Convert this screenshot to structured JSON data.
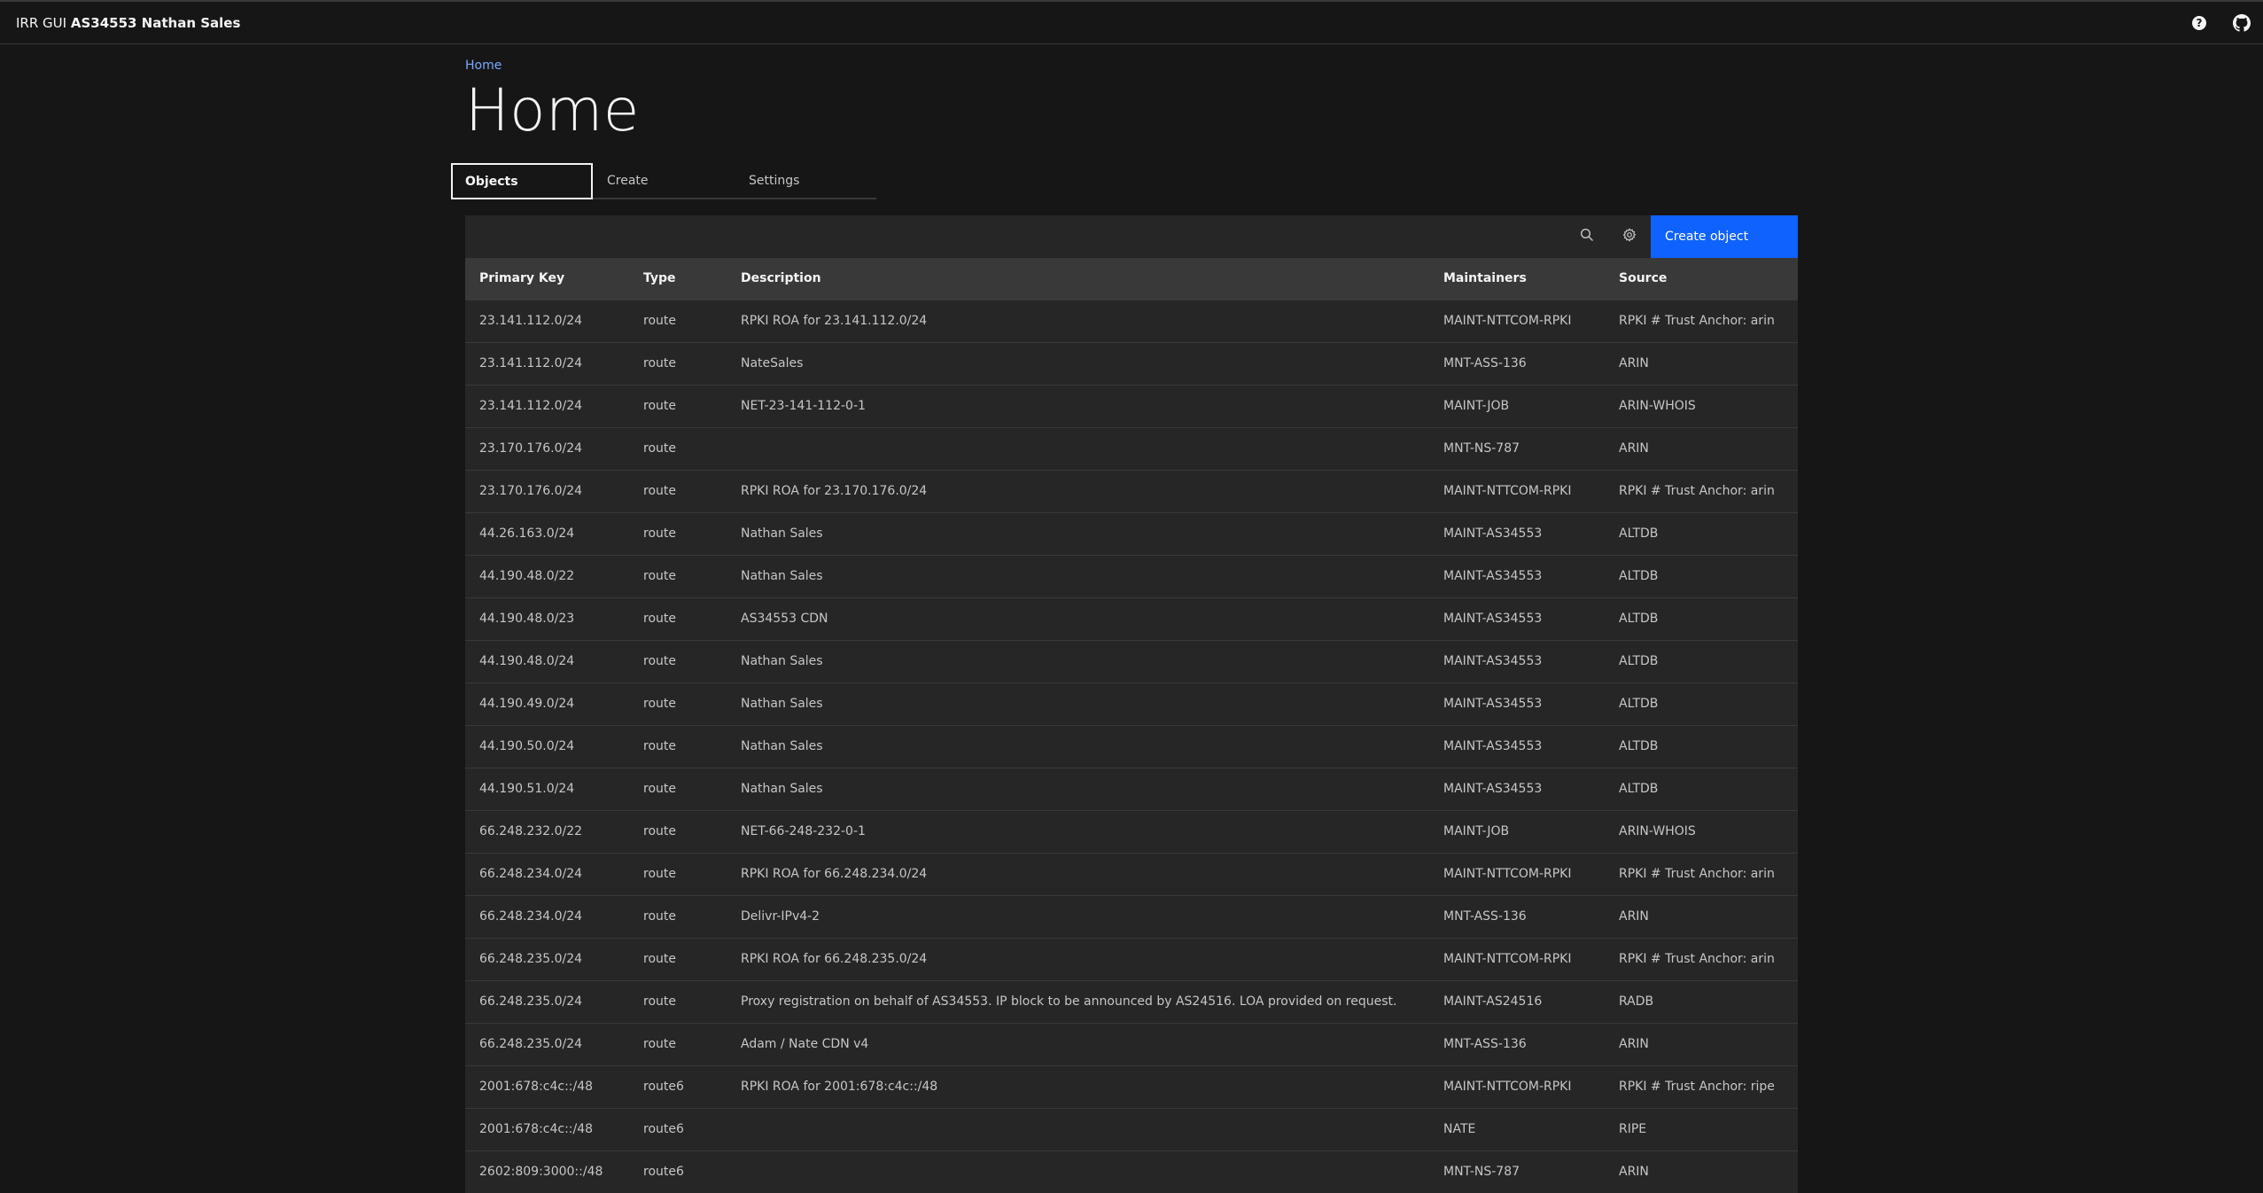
{
  "header": {
    "prefix": "IRR GUI",
    "name": "AS34553 Nathan Sales",
    "help_icon": "help-icon",
    "github_icon": "github-icon"
  },
  "breadcrumb": {
    "home": "Home"
  },
  "page": {
    "title": "Home"
  },
  "tabs": [
    {
      "label": "Objects",
      "active": true
    },
    {
      "label": "Create",
      "active": false
    },
    {
      "label": "Settings",
      "active": false
    }
  ],
  "toolbar": {
    "search_icon": "search-icon",
    "settings_icon": "gear-icon",
    "create_label": "Create object"
  },
  "table": {
    "headers": [
      "Primary Key",
      "Type",
      "Description",
      "Maintainers",
      "Source"
    ],
    "rows": [
      [
        "23.141.112.0/24",
        "route",
        "RPKI ROA for 23.141.112.0/24",
        "MAINT-NTTCOM-RPKI",
        "RPKI # Trust Anchor: arin"
      ],
      [
        "23.141.112.0/24",
        "route",
        "NateSales",
        "MNT-ASS-136",
        "ARIN"
      ],
      [
        "23.141.112.0/24",
        "route",
        "NET-23-141-112-0-1",
        "MAINT-JOB",
        "ARIN-WHOIS"
      ],
      [
        "23.170.176.0/24",
        "route",
        "",
        "MNT-NS-787",
        "ARIN"
      ],
      [
        "23.170.176.0/24",
        "route",
        "RPKI ROA for 23.170.176.0/24",
        "MAINT-NTTCOM-RPKI",
        "RPKI # Trust Anchor: arin"
      ],
      [
        "44.26.163.0/24",
        "route",
        "Nathan Sales",
        "MAINT-AS34553",
        "ALTDB"
      ],
      [
        "44.190.48.0/22",
        "route",
        "Nathan Sales",
        "MAINT-AS34553",
        "ALTDB"
      ],
      [
        "44.190.48.0/23",
        "route",
        "AS34553 CDN",
        "MAINT-AS34553",
        "ALTDB"
      ],
      [
        "44.190.48.0/24",
        "route",
        "Nathan Sales",
        "MAINT-AS34553",
        "ALTDB"
      ],
      [
        "44.190.49.0/24",
        "route",
        "Nathan Sales",
        "MAINT-AS34553",
        "ALTDB"
      ],
      [
        "44.190.50.0/24",
        "route",
        "Nathan Sales",
        "MAINT-AS34553",
        "ALTDB"
      ],
      [
        "44.190.51.0/24",
        "route",
        "Nathan Sales",
        "MAINT-AS34553",
        "ALTDB"
      ],
      [
        "66.248.232.0/22",
        "route",
        "NET-66-248-232-0-1",
        "MAINT-JOB",
        "ARIN-WHOIS"
      ],
      [
        "66.248.234.0/24",
        "route",
        "RPKI ROA for 66.248.234.0/24",
        "MAINT-NTTCOM-RPKI",
        "RPKI # Trust Anchor: arin"
      ],
      [
        "66.248.234.0/24",
        "route",
        "Delivr-IPv4-2",
        "MNT-ASS-136",
        "ARIN"
      ],
      [
        "66.248.235.0/24",
        "route",
        "RPKI ROA for 66.248.235.0/24",
        "MAINT-NTTCOM-RPKI",
        "RPKI # Trust Anchor: arin"
      ],
      [
        "66.248.235.0/24",
        "route",
        "Proxy registration on behalf of AS34553. IP block to be announced by AS24516. LOA provided on request.",
        "MAINT-AS24516",
        "RADB"
      ],
      [
        "66.248.235.0/24",
        "route",
        "Adam / Nate CDN v4",
        "MNT-ASS-136",
        "ARIN"
      ],
      [
        "2001:678:c4c::/48",
        "route6",
        "RPKI ROA for 2001:678:c4c::/48",
        "MAINT-NTTCOM-RPKI",
        "RPKI # Trust Anchor: ripe"
      ],
      [
        "2001:678:c4c::/48",
        "route6",
        "",
        "NATE",
        "RIPE"
      ],
      [
        "2602:809:3000::/48",
        "route6",
        "",
        "MNT-NS-787",
        "ARIN"
      ]
    ]
  }
}
